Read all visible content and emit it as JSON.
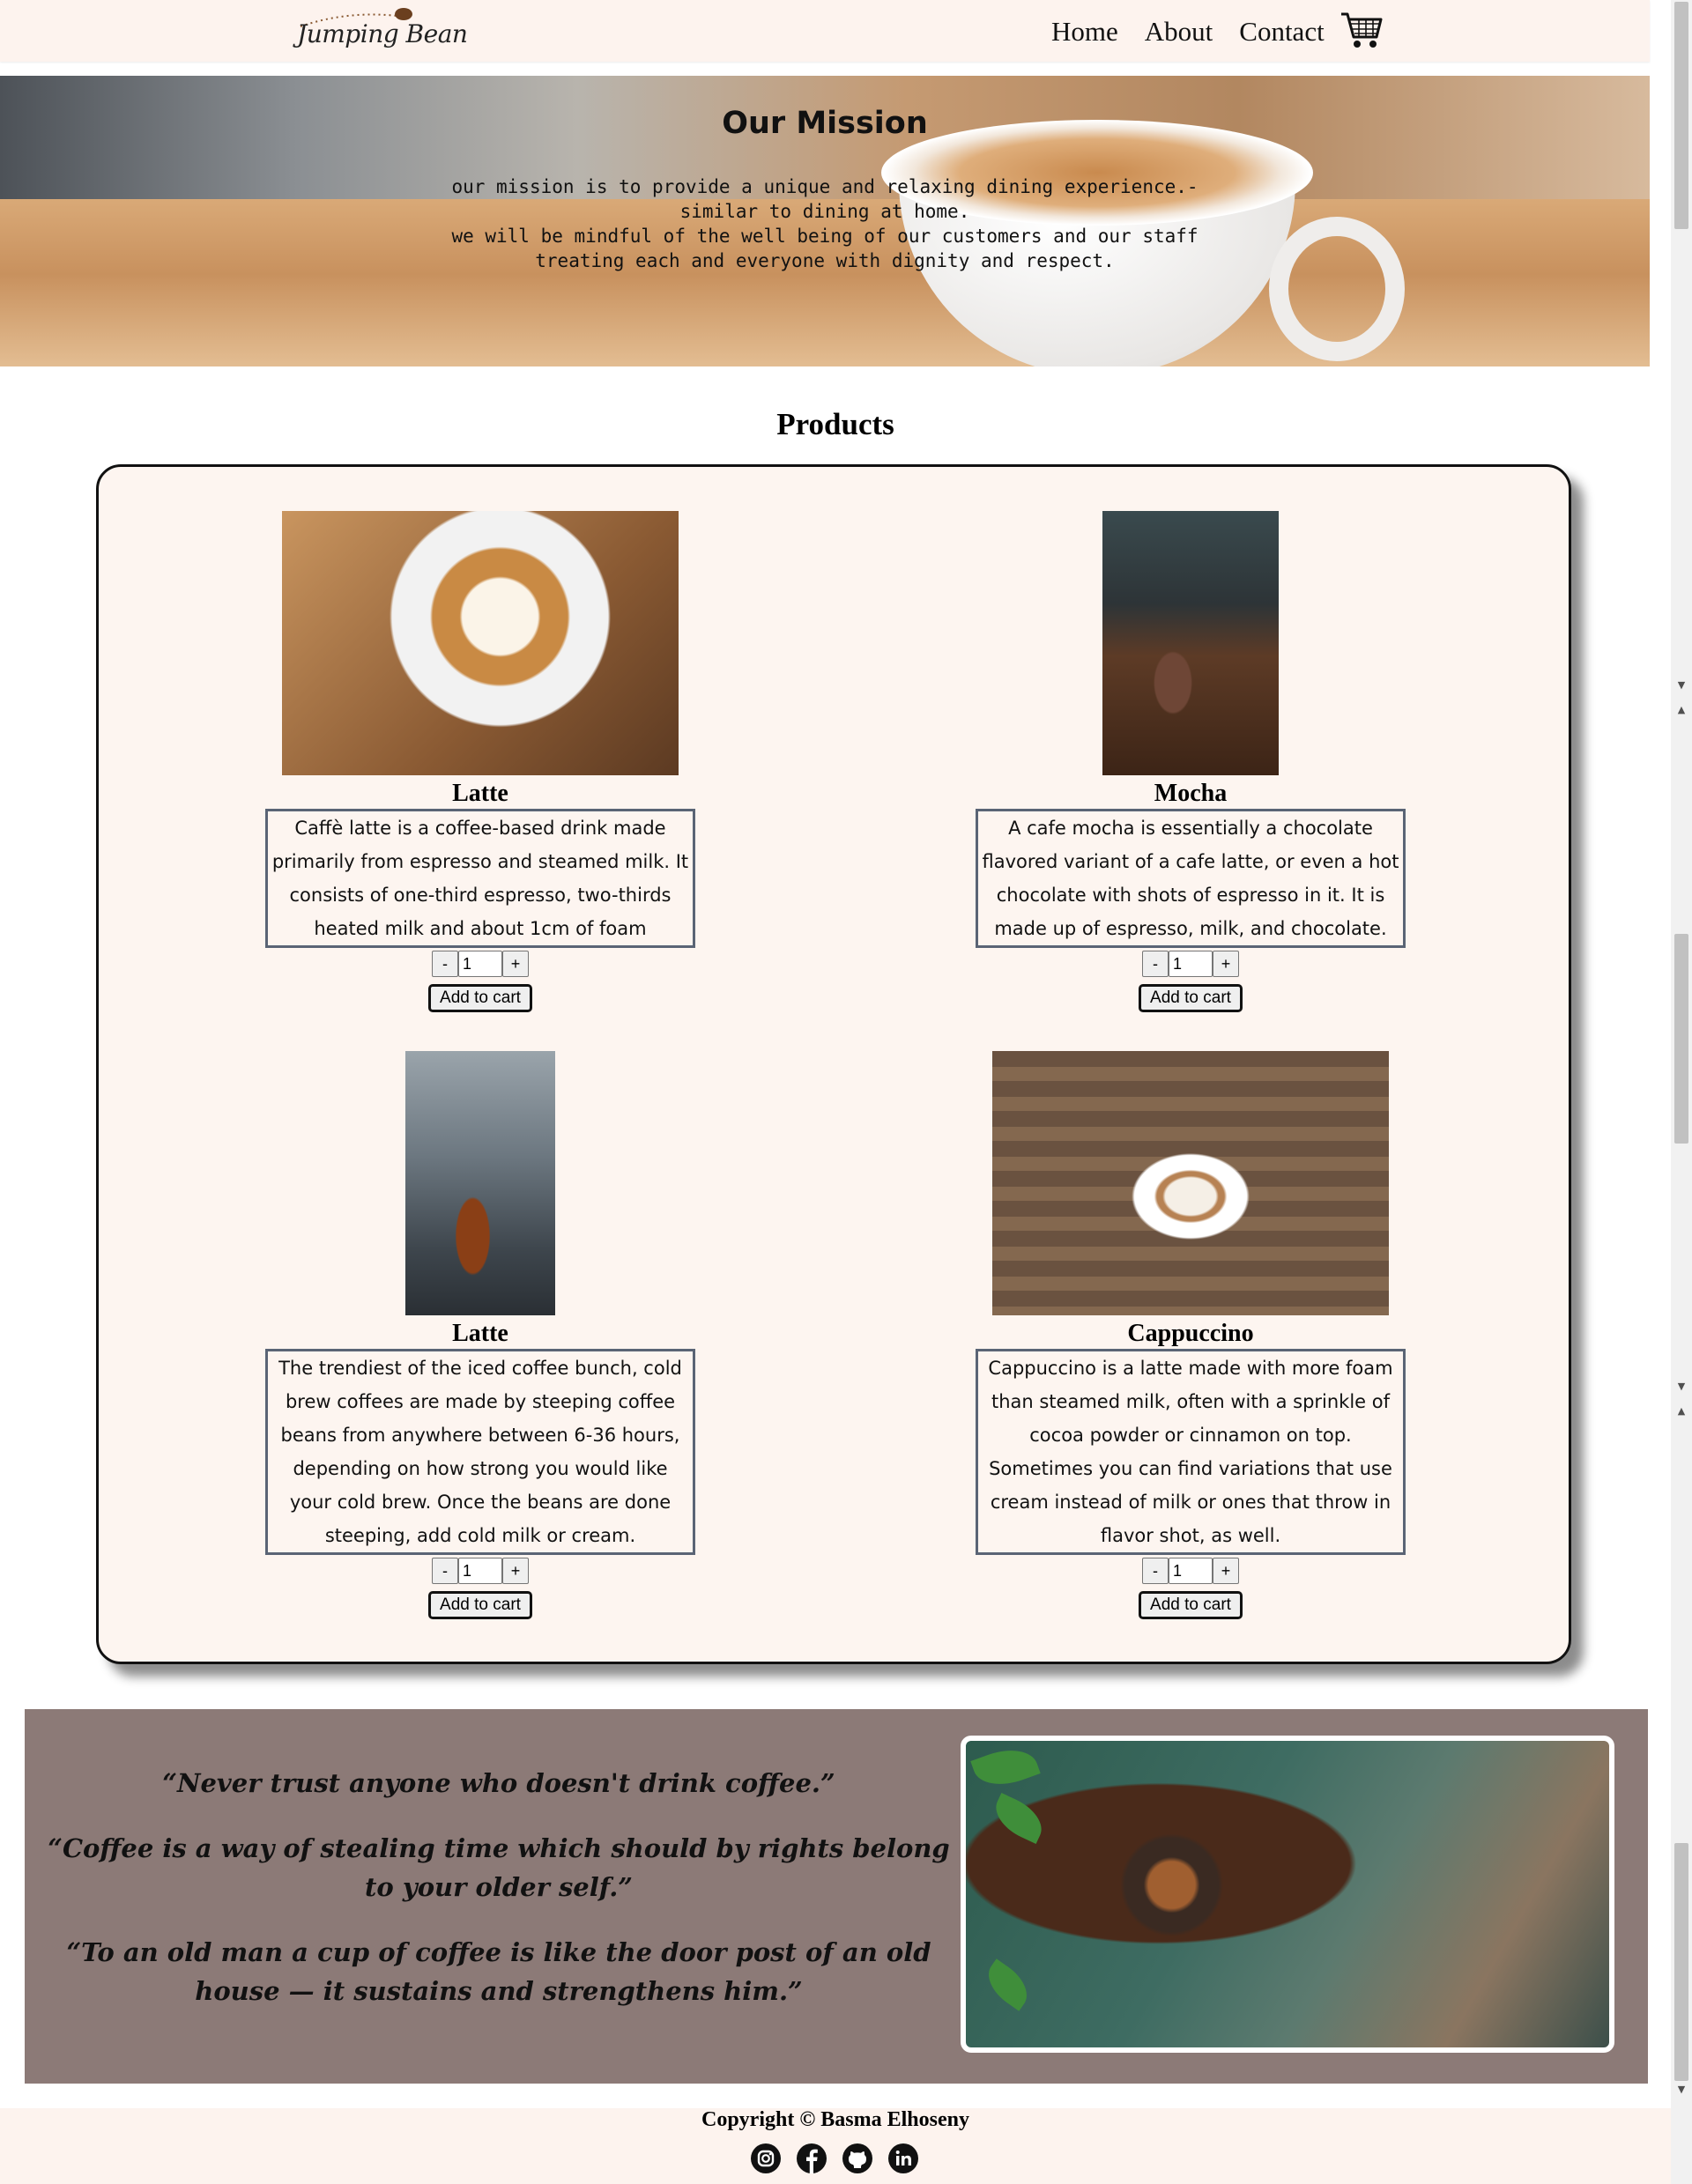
{
  "header": {
    "logo_text": "Jumping Bean",
    "nav": [
      "Home",
      "About",
      "Contact"
    ],
    "cart_icon": "shopping-cart-icon"
  },
  "mission": {
    "title": "Our Mission",
    "lines": [
      "our mission is to provide a unique and relaxing dining experience.-",
      "similar to dining at home.",
      "we will be mindful of the well being of our customers and our staff",
      "treating each and everyone with dignity and respect."
    ]
  },
  "products": {
    "title": "Products",
    "items": [
      {
        "name": "Latte",
        "description": "Caffè latte is a coffee-based drink made primarily from espresso and steamed milk. It consists of one-third espresso, two-thirds heated milk and about 1cm of foam",
        "quantity": "1",
        "minus": "-",
        "plus": "+",
        "add_label": "Add to cart"
      },
      {
        "name": "Mocha",
        "description": "A cafe mocha is essentially a chocolate flavored variant of a cafe latte, or even a hot chocolate with shots of espresso in it. It is made up of espresso, milk, and chocolate.",
        "quantity": "1",
        "minus": "-",
        "plus": "+",
        "add_label": "Add to cart"
      },
      {
        "name": "Latte",
        "description": "The trendiest of the iced coffee bunch, cold brew coffees are made by steeping coffee beans from anywhere between 6-36 hours, depending on how strong you would like your cold brew. Once the beans are done steeping, add cold milk or cream.",
        "quantity": "1",
        "minus": "-",
        "plus": "+",
        "add_label": "Add to cart"
      },
      {
        "name": "Cappuccino",
        "description": "Cappuccino is a latte made with more foam than steamed milk, often with a sprinkle of cocoa powder or cinnamon on top. Sometimes you can find variations that use cream instead of milk or ones that throw in flavor shot, as well.",
        "quantity": "1",
        "minus": "-",
        "plus": "+",
        "add_label": "Add to cart"
      }
    ]
  },
  "quotes": [
    "“Never trust anyone who doesn't drink coffee.”",
    "“Coffee is a way of stealing time which should by rights belong to your older self.”",
    "“To an old man a cup of coffee is like the door post of an old house — it sustains and strengthens him.”"
  ],
  "footer": {
    "copyright": "Copyright © Basma Elhoseny",
    "social_icons": [
      "instagram-icon",
      "facebook-icon",
      "github-icon",
      "linkedin-icon"
    ]
  },
  "colors": {
    "header_bg": "#fdf3ee",
    "quotes_bg": "#8c7a77",
    "card_bg": "#fdf5f0",
    "desc_border": "#5a6475"
  }
}
